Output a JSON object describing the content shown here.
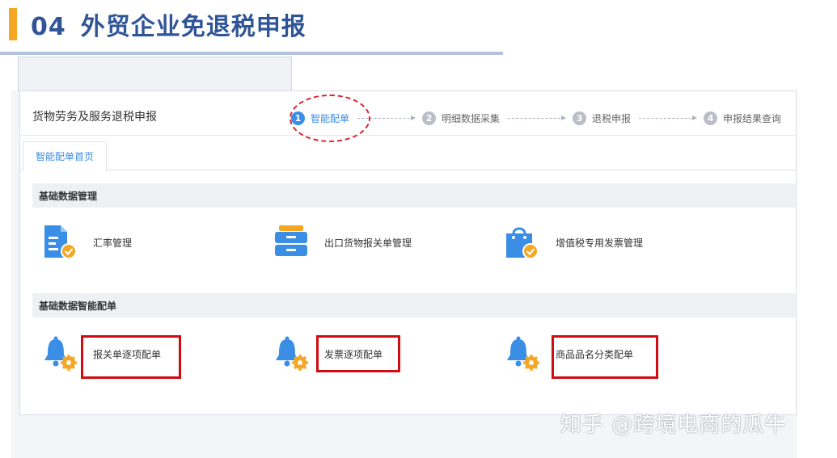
{
  "slide": {
    "number": "04",
    "title": "外贸企业免退税申报"
  },
  "header": {
    "page_name": "货物劳务及服务退税申报"
  },
  "steps": [
    {
      "index": "1",
      "label": "智能配单",
      "active": true
    },
    {
      "index": "2",
      "label": "明细数据采集",
      "active": false
    },
    {
      "index": "3",
      "label": "退税申报",
      "active": false
    },
    {
      "index": "4",
      "label": "申报结果查询",
      "active": false
    }
  ],
  "tabs": {
    "home": "智能配单首页"
  },
  "sections": {
    "basic_data": {
      "title": "基础数据管理",
      "items": [
        {
          "label": "汇率管理",
          "icon": "exchange-rate-document-icon"
        },
        {
          "label": "出口货物报关单管理",
          "icon": "cabinet-drawer-icon"
        },
        {
          "label": "增值税专用发票管理",
          "icon": "shopping-bag-check-icon"
        }
      ]
    },
    "smart_match": {
      "title": "基础数据智能配单",
      "items": [
        {
          "label": "报关单逐项配单",
          "icon": "bell-gear-icon"
        },
        {
          "label": "发票逐项配单",
          "icon": "bell-gear-icon"
        },
        {
          "label": "商品品名分类配单",
          "icon": "bell-gear-icon"
        }
      ]
    }
  },
  "colors": {
    "accent_blue": "#3a8ee6",
    "title_blue": "#2f5597",
    "highlight_red": "#d00c12",
    "icon_orange": "#f5a623"
  },
  "watermark": "知乎 @跨境电商的瓜牛"
}
